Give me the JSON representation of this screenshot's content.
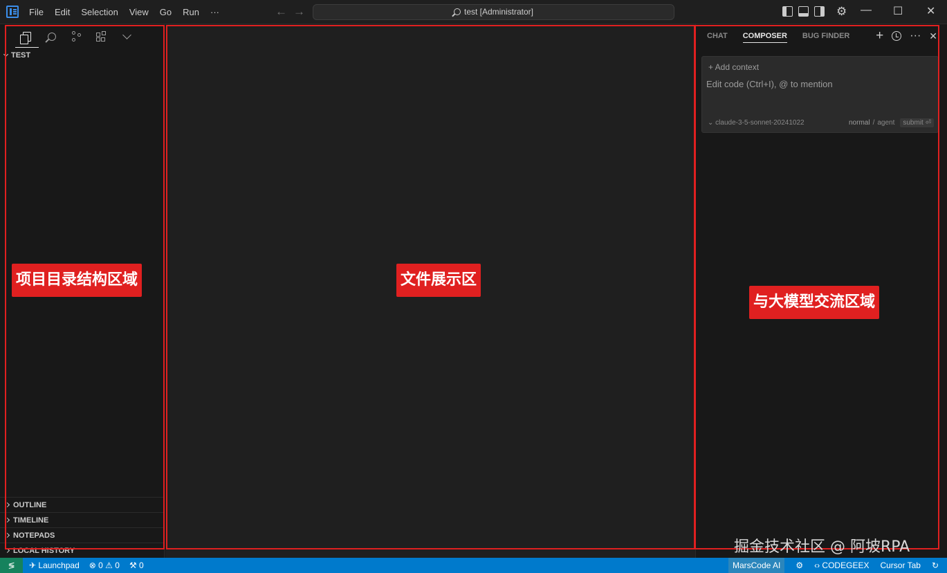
{
  "titlebar": {
    "menu": [
      "File",
      "Edit",
      "Selection",
      "View",
      "Go",
      "Run",
      "···"
    ],
    "back_arrow": "←",
    "forward_arrow": "→",
    "command_center": "test [Administrator]",
    "gear": "⚙",
    "minimize": "—",
    "maximize": "☐",
    "close": "✕"
  },
  "sidebar": {
    "root_folder": "TEST",
    "sections": [
      "OUTLINE",
      "TIMELINE",
      "NOTEPADS",
      "LOCAL HISTORY"
    ]
  },
  "right_panel": {
    "tabs": [
      "CHAT",
      "COMPOSER",
      "BUG FINDER"
    ],
    "active_tab": "COMPOSER",
    "new_chat": "+",
    "more": "···",
    "close": "✕",
    "add_context": "+ Add context",
    "input_placeholder": "Edit code (Ctrl+I), @ to mention",
    "model": "⌄ claude-3-5-sonnet-20241022",
    "mode_normal": "normal",
    "mode_sep": "/",
    "mode_agent": "agent",
    "submit": "submit ⏎"
  },
  "annotations": {
    "project_tree": "项目目录结构区域",
    "file_area": "文件展示区",
    "llm_area": "与大模型交流区域"
  },
  "statusbar": {
    "remote": "≶",
    "launchpad": "✈ Launchpad",
    "problems": "⊗ 0 ⚠ 0",
    "ports": "⚒ 0",
    "marscode": "MarsCode AI",
    "codegeex": "‹› CODEGEEX",
    "cursor_tab": "Cursor Tab",
    "bell": "↻"
  },
  "watermark": "掘金技术社区 @ 阿坡RPA",
  "colors": {
    "accent": "#007acc",
    "annotation_red": "#e02020",
    "remote_green": "#16825d"
  },
  "icons": [
    "files-icon",
    "search-icon",
    "source-control-icon",
    "extensions-icon",
    "chevron-down-icon",
    "history-icon",
    "gear-icon"
  ]
}
